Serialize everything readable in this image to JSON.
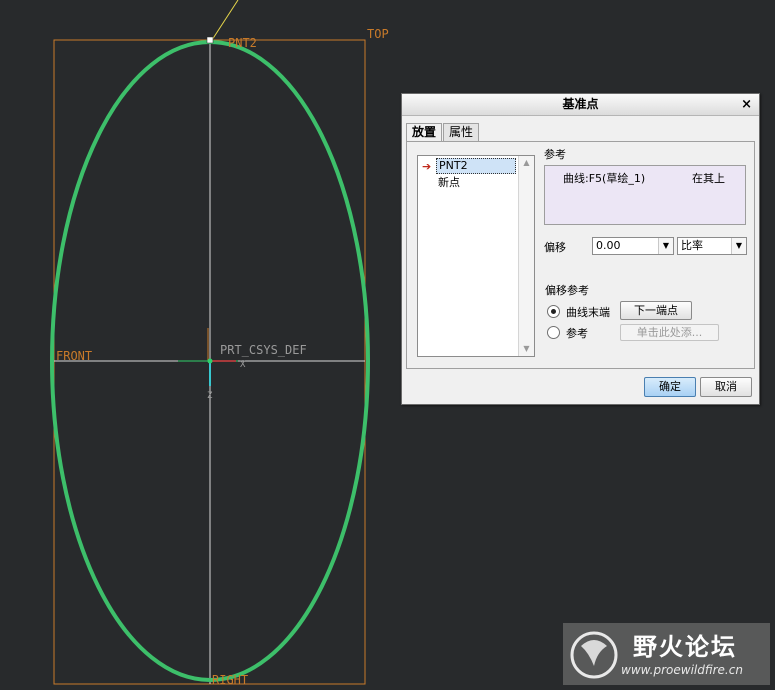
{
  "viewport": {
    "labels": {
      "top": "TOP",
      "front": "FRONT",
      "right": "RIGHT",
      "point": "PNT2",
      "csys": "PRT_CSYS_DEF",
      "x_axis": "X",
      "z_axis": "Z"
    },
    "colors": {
      "background": "#282a2c",
      "ellipse": "#3dbf6a",
      "plane": "#c87a2a",
      "datum_line": "#d8d8d8",
      "csys": "#2fd06a"
    }
  },
  "dialog": {
    "title": "基准点",
    "close_label": "×",
    "tabs": [
      {
        "label": "放置",
        "active": true
      },
      {
        "label": "属性",
        "active": false
      }
    ],
    "point_list": {
      "items": [
        "PNT2",
        "新点"
      ],
      "selected": "PNT2"
    },
    "references": {
      "label": "参考",
      "entry_ref": "曲线:F5(草绘_1)",
      "entry_constraint": "在其上"
    },
    "offset": {
      "label": "偏移",
      "value": "0.00",
      "mode": "比率"
    },
    "offset_reference": {
      "label": "偏移参考",
      "option_curve_end": "曲线末端",
      "option_reference": "参考",
      "selected": "曲线末端",
      "next_endpoint_button": "下一端点",
      "click_to_add": "单击此处添..."
    },
    "ok_button": "确定",
    "cancel_button": "取消"
  },
  "watermark": {
    "title": "野火论坛",
    "url": "www.proewildfire.cn"
  }
}
